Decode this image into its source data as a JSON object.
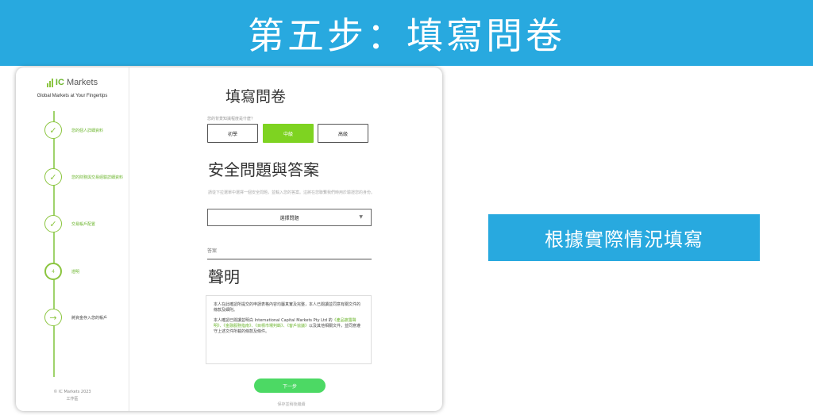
{
  "banner": {
    "title": "第五步：填寫問卷"
  },
  "callout": {
    "text": "根據實際情況填寫"
  },
  "brand": {
    "name_prefix": "IC",
    "name_suffix": " Markets",
    "tagline": "Global Markets at Your Fingertips",
    "accent_color": "#8bc53f",
    "banner_color": "#28a9df"
  },
  "steps": [
    {
      "label": "您的個人詳細資料",
      "status": "done",
      "icon": "check-icon",
      "symbol": "✓"
    },
    {
      "label": "您的財務與交易經驗詳細資料",
      "status": "done",
      "icon": "check-icon",
      "symbol": "✓"
    },
    {
      "label": "交易帳戶配置",
      "status": "done",
      "icon": "check-icon",
      "symbol": "✓"
    },
    {
      "label": "證明",
      "status": "current",
      "icon": "step-number",
      "symbol": "4"
    },
    {
      "label": "將資金存入您的帳戶",
      "status": "pending",
      "icon": "arrow-right-icon",
      "symbol": "→"
    }
  ],
  "sidebar_footer": {
    "line1": "© IC Markets 2023",
    "line2": "工作區"
  },
  "form": {
    "title": "填寫問卷",
    "question_label": "您的背景知識程度是什麼？",
    "options": [
      {
        "label": "初學",
        "selected": false
      },
      {
        "label": "中級",
        "selected": true
      },
      {
        "label": "高級",
        "selected": false
      }
    ],
    "security_title": "安全問題與答案",
    "security_desc": "請從下拉選單中選擇一個安全問題，並輸入您的答案。這將在您聯繫我們時用於驗證您的身份。",
    "select_value": "選擇問題",
    "answer_label": "答案",
    "declaration_title": "聲明",
    "declaration_p1": "本人在此確認所提交的申請表格內容均屬真實及完整，本人已閱讀並同意有關文件的條款及細則。",
    "declaration_p2_prefix": "本人確認已閱讀並明白 International Capital Markets Pty Ltd 的",
    "declaration_links": "《產品披露聲明》、《金融服務指南》、《目標市場判斷》、《客戶協議》",
    "declaration_p2_suffix": "以及其他相關文件，並同意遵守上述文件所載的條款及條件。",
    "next_label": "下一步",
    "save_label": "保存並稍後繼續"
  }
}
